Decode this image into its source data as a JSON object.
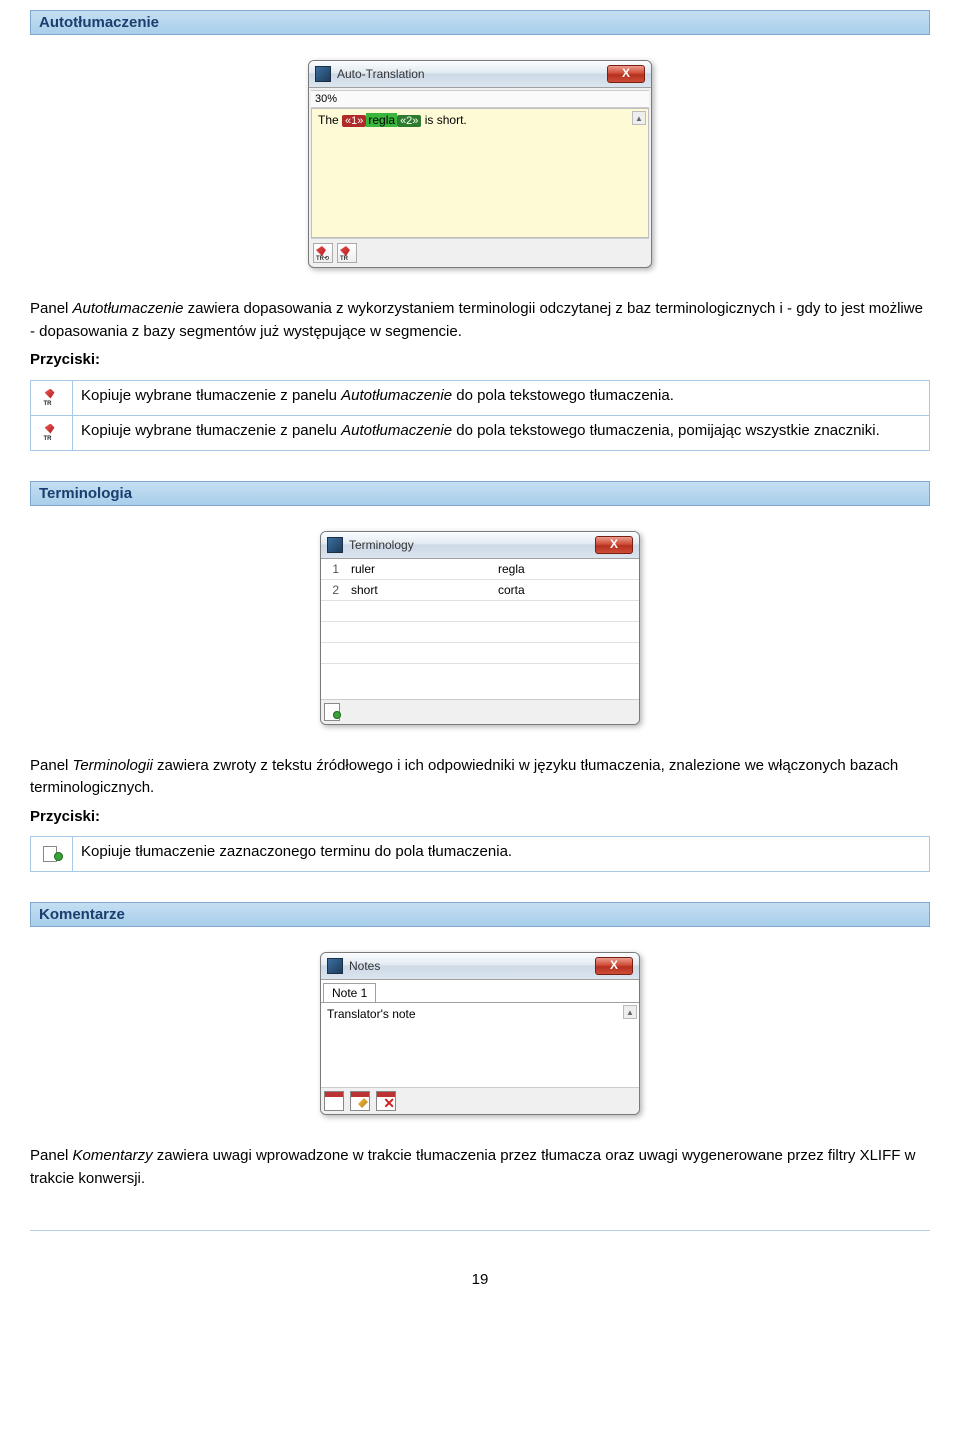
{
  "section1": {
    "title": "Autotłumaczenie",
    "panel": {
      "window_title": "Auto-Translation",
      "percent": "30%",
      "sentence_pre": "The ",
      "tag1": "«1»",
      "highlight": "regla",
      "tag2": "«2»",
      "sentence_post": " is short."
    },
    "para_pre": "Panel ",
    "para_em": "Autotłumaczenie",
    "para_post": " zawiera dopasowania z wykorzystaniem terminologii odczytanej z baz terminologicznych i - gdy to jest możliwe - dopasowania z bazy segmentów już występujące w segmencie.",
    "buttons_label": "Przyciski:",
    "btn1_pre": "Kopiuje wybrane tłumaczenie z panelu ",
    "btn1_em": "Autotłumaczenie",
    "btn1_post": " do pola tekstowego tłumaczenia.",
    "btn2_pre": "Kopiuje wybrane tłumaczenie z panelu ",
    "btn2_em": "Autotłumaczenie",
    "btn2_post": " do pola tekstowego tłumaczenia, pomijając wszystkie znaczniki."
  },
  "section2": {
    "title": "Terminologia",
    "panel": {
      "window_title": "Terminology",
      "rows": [
        {
          "n": "1",
          "src": "ruler",
          "tgt": "regla"
        },
        {
          "n": "2",
          "src": "short",
          "tgt": "corta"
        }
      ]
    },
    "para_pre": "Panel ",
    "para_em": "Terminologii",
    "para_post": " zawiera zwroty z tekstu źródłowego i ich odpowiedniki w języku tłumaczenia, znalezione we włączonych bazach terminologicznych.",
    "buttons_label": "Przyciski:",
    "btn1": "Kopiuje tłumaczenie zaznaczonego terminu do pola tłumaczenia."
  },
  "section3": {
    "title": "Komentarze",
    "panel": {
      "window_title": "Notes",
      "tab": "Note 1",
      "content": "Translator's note"
    },
    "para_pre": "Panel ",
    "para_em": "Komentarzy",
    "para_post": " zawiera uwagi wprowadzone w trakcie tłumaczenia przez tłumacza oraz uwagi wygenerowane przez filtry XLIFF w trakcie konwersji."
  },
  "page_number": "19"
}
